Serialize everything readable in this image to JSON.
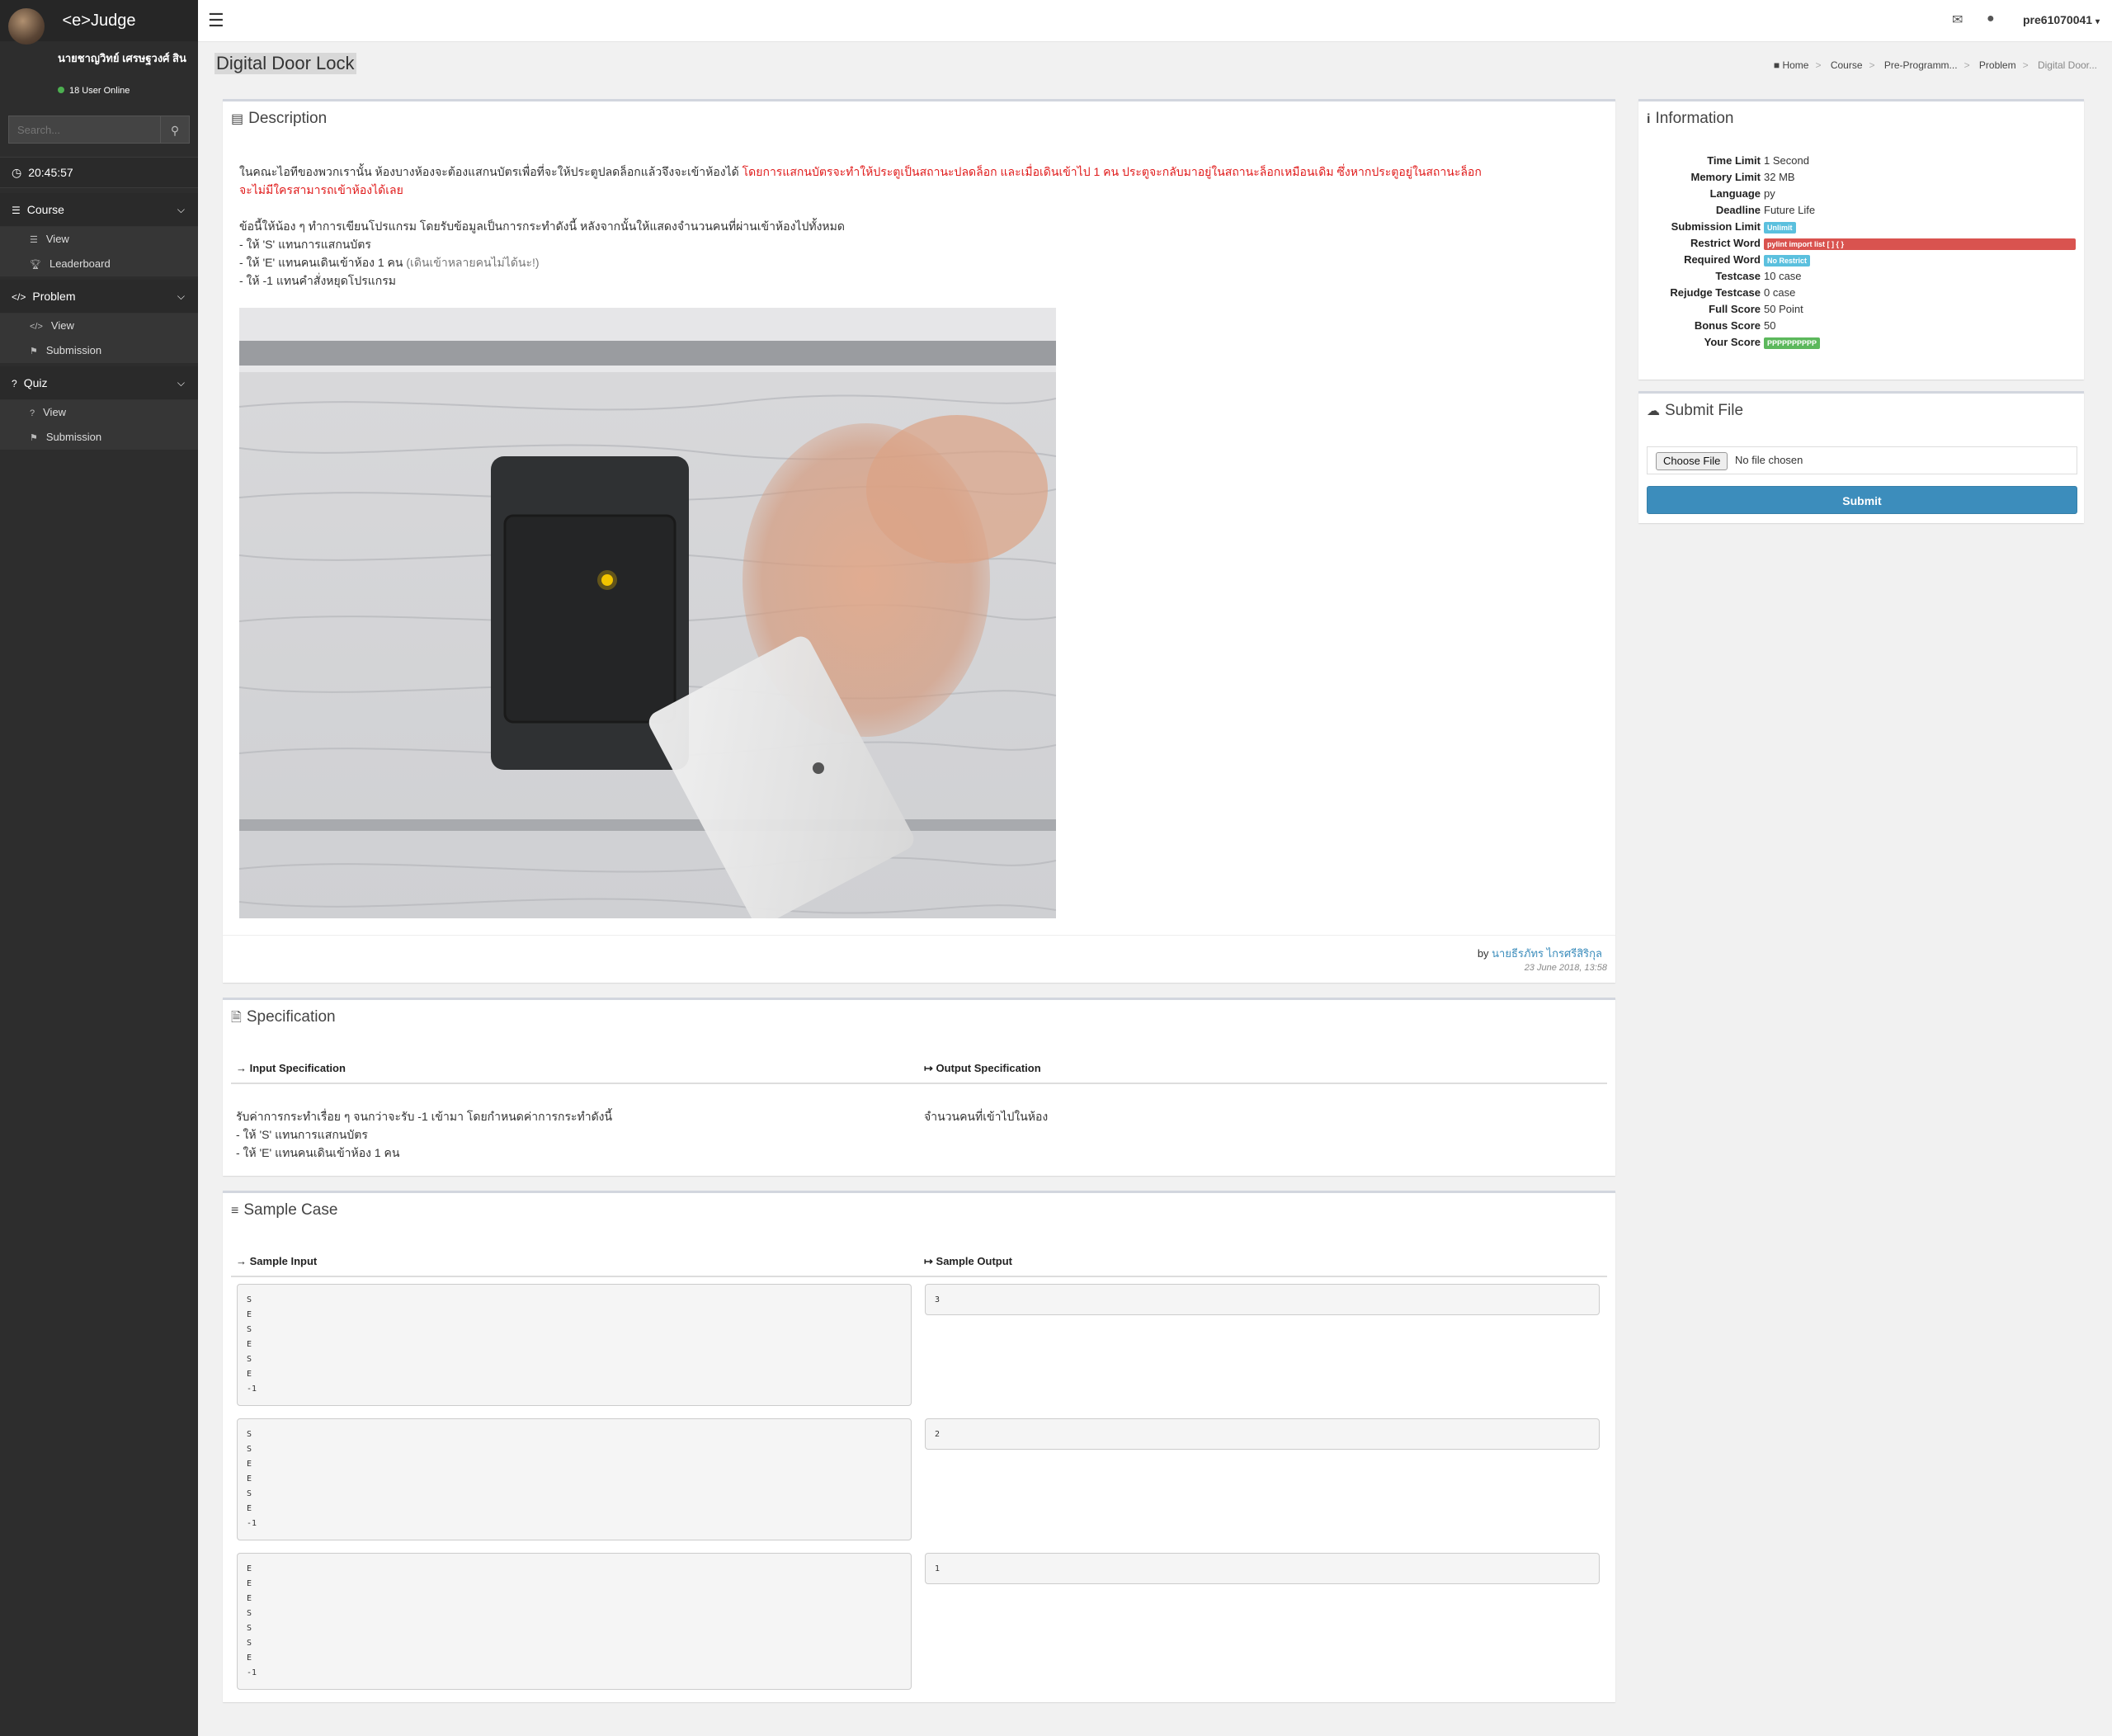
{
  "sidebar": {
    "brand": "<e>Judge",
    "user_name": "นายชาญวิทย์ เศรษฐวงศ์ สิน",
    "online": "18 User Online",
    "search_placeholder": "Search...",
    "clock": "20:45:57",
    "groups": [
      {
        "label": "Course",
        "items": [
          {
            "label": "View"
          },
          {
            "label": "Leaderboard"
          }
        ]
      },
      {
        "label": "Problem",
        "items": [
          {
            "label": "View"
          },
          {
            "label": "Submission"
          }
        ]
      },
      {
        "label": "Quiz",
        "items": [
          {
            "label": "View"
          },
          {
            "label": "Submission"
          }
        ]
      }
    ]
  },
  "topbar": {
    "user": "pre61070041"
  },
  "page": {
    "title": "Digital Door Lock",
    "breadcrumb": [
      "Home",
      "Course",
      "Pre-Programm...",
      "Problem",
      "Digital Door..."
    ]
  },
  "description": {
    "heading": "Description",
    "para1_black": "ในคณะไอทีของพวกเรานั้น ห้องบางห้องจะต้องแสกนบัตรเพื่อที่จะให้ประตูปลดล็อกแล้วจึงจะเข้าห้องได้ ",
    "para1_red_line1": "โดยการแสกนบัตรจะทำให้ประตูเป็นสถานะปลดล็อก และเมื่อเดินเข้าไป 1 คน ประตูจะกลับมาอยู่ในสถานะล็อกเหมือนเดิม ซึ่งหากประตูอยู่ในสถานะล็อก",
    "para1_red_line2": "จะไม่มีใครสามารถเข้าห้องได้เลย",
    "para2": "ข้อนี้ให้น้อง ๆ ทำการเขียนโปรแกรม โดยรับข้อมูลเป็นการกระทำดังนี้ หลังจากนั้นให้แสดงจำนวนคนที่ผ่านเข้าห้องไปทั้งหมด",
    "bullet1": "- ให้ 'S' แทนการแสกนบัตร",
    "bullet2": "- ให้ 'E' แทนคนเดินเข้าห้อง 1 คน ",
    "bullet2_note": "(เดินเข้าหลายคนไม่ได้นะ!)",
    "bullet3": "- ให้ -1 แทนคำสั่งหยุดโปรแกรม",
    "by": "by ",
    "author": "นายธีรภัทร ไกรศรีสิริกุล",
    "posted": "23 June 2018, 13:58"
  },
  "specification": {
    "heading": "Specification",
    "input_head": "Input Specification",
    "output_head": "Output Specification",
    "input_line1": "รับค่าการกระทำเรื่อย ๆ จนกว่าจะรับ -1 เข้ามา โดยกำหนดค่าการกระทำดังนี้",
    "input_line2": "- ให้ 'S' แทนการแสกนบัตร",
    "input_line3": "- ให้ 'E' แทนคนเดินเข้าห้อง 1 คน",
    "output_line1": "จำนวนคนที่เข้าไปในห้อง"
  },
  "samples": {
    "heading": "Sample Case",
    "input_head": "Sample Input",
    "output_head": "Sample Output",
    "cases": [
      {
        "input": "S\nE\nS\nE\nS\nE\n-1",
        "output": "3"
      },
      {
        "input": "S\nS\nE\nE\nS\nE\n-1",
        "output": "2"
      },
      {
        "input": "E\nE\nE\nS\nS\nS\nE\n-1",
        "output": "1"
      }
    ]
  },
  "information": {
    "heading": "Information",
    "rows": [
      {
        "label": "Time Limit",
        "value": "1 Second"
      },
      {
        "label": "Memory Limit",
        "value": "32 MB"
      },
      {
        "label": "Language",
        "value": "py"
      },
      {
        "label": "Deadline",
        "value": "Future Life"
      },
      {
        "label": "Submission Limit",
        "value": "Unlimit"
      },
      {
        "label": "Restrict Word",
        "value": "pylint import list [ ] { }"
      },
      {
        "label": "Required Word",
        "value": "No Restrict"
      },
      {
        "label": "Testcase",
        "value": "10 case"
      },
      {
        "label": "Rejudge Testcase",
        "value": "0 case"
      },
      {
        "label": "Full Score",
        "value": "50 Point"
      },
      {
        "label": "Bonus Score",
        "value": "50"
      },
      {
        "label": "Your Score",
        "value": "PPPPPPPPPP"
      }
    ],
    "colors": {
      "info": "#5bc0de",
      "danger": "#d9534f",
      "success": "#5cb85c"
    }
  },
  "submit": {
    "heading": "Submit File",
    "choose": "Choose File",
    "no_file": "No file chosen",
    "button": "Submit"
  }
}
